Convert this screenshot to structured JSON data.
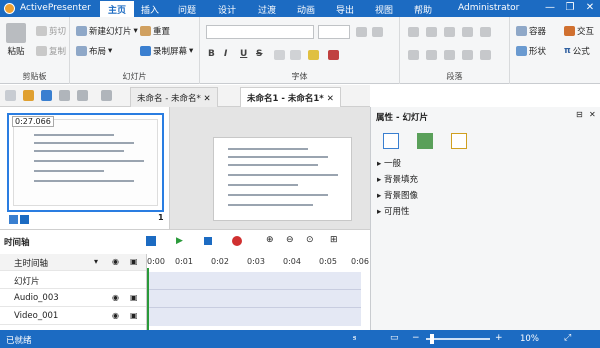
{
  "app": {
    "title": "ActivePresenter",
    "user": "Administrator"
  },
  "menu": [
    "主页",
    "插入",
    "问题",
    "设计",
    "过渡",
    "动画",
    "导出",
    "视图",
    "帮助"
  ],
  "window_controls": {
    "minimize": "—",
    "restore": "❐",
    "close": "✕"
  },
  "ribbon": {
    "clipboard": {
      "paste": "粘贴",
      "cut": "剪切",
      "copy": "复制",
      "label": "剪贴板"
    },
    "slides": {
      "new_slide": "新建幻灯片",
      "layout": "布局",
      "reset": "重置",
      "record_screen": "录制屏幕",
      "label": "幻灯片"
    },
    "font": {
      "label": "字体",
      "bold": "B",
      "italic": "I",
      "underline": "U",
      "strike": "S"
    },
    "paragraph": {
      "label": "段落"
    },
    "drawing": {
      "container": "容器",
      "interact": "交互",
      "shape": "形状",
      "formula": "公式"
    }
  },
  "tabs": [
    {
      "label": "未命名 - 未命名*"
    },
    {
      "label": "未命名1 - 未命名1*"
    }
  ],
  "slide_thumb": {
    "duration": "0:27.066",
    "number": "1"
  },
  "properties": {
    "header": "属性 - 幻灯片",
    "sections": [
      "一般",
      "背景填充",
      "背景图像",
      "可用性"
    ]
  },
  "timeline": {
    "title": "时间轴",
    "rows": [
      "主时间轴",
      "幻灯片",
      "Audio_003",
      "Video_001"
    ],
    "ruler": [
      "0:00",
      "0:01",
      "0:02",
      "0:03",
      "0:04",
      "0:05",
      "0:06"
    ]
  },
  "status": {
    "ready": "已就绪",
    "zoom": "10%"
  },
  "colors": {
    "accent": "#1c6bc2",
    "selection": "#2a7de1",
    "track": "#e4e8f4"
  }
}
